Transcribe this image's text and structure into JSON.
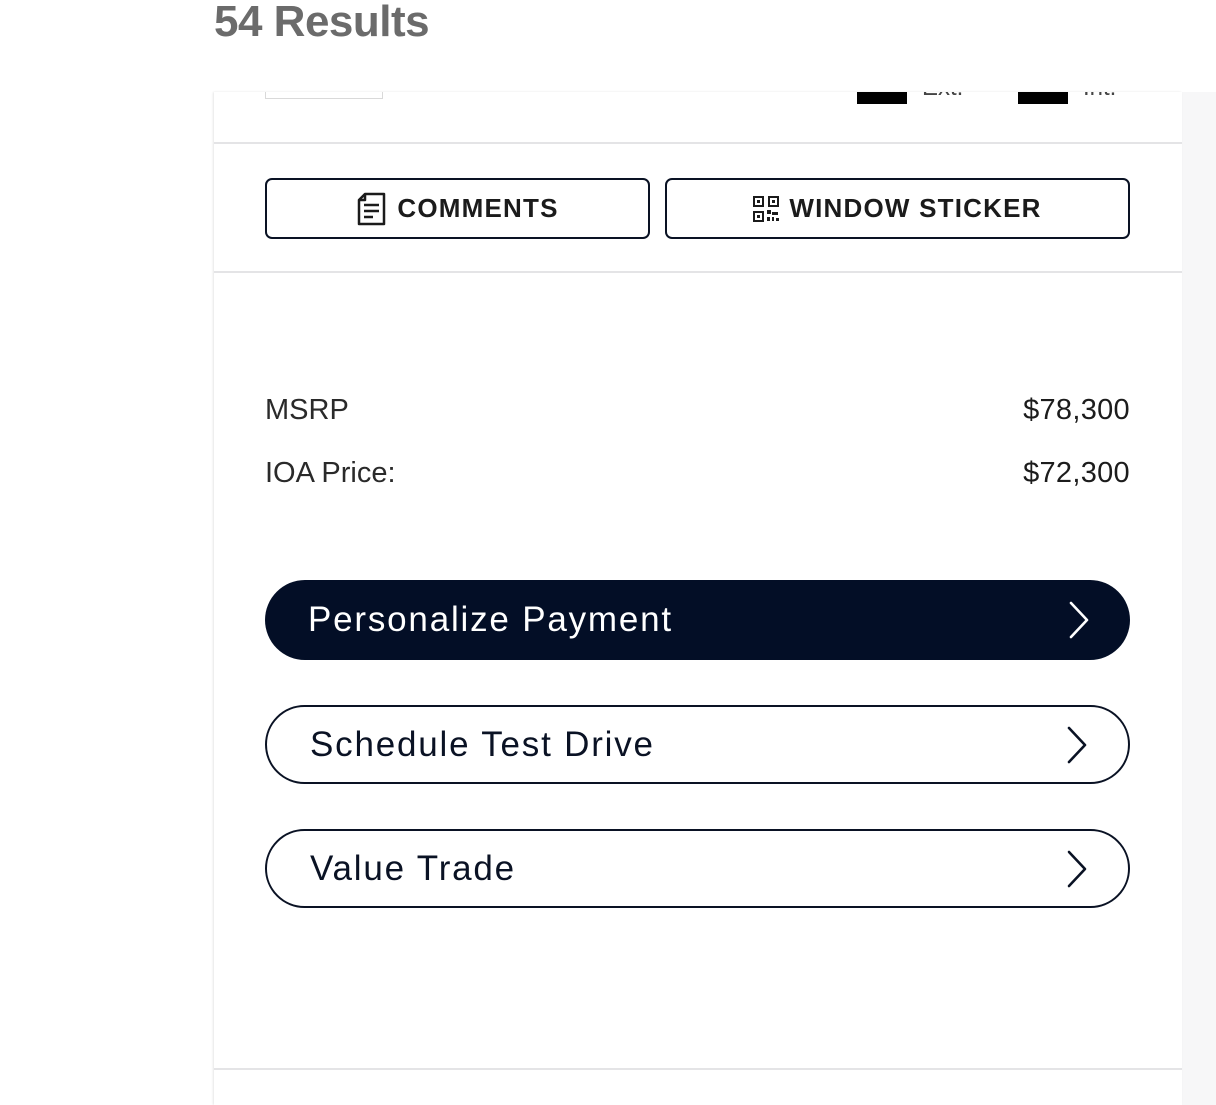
{
  "header": {
    "results_title": "54 Results"
  },
  "card": {
    "clipped_row": {
      "option_labels": [
        "Ext.",
        "Int."
      ]
    },
    "actions": {
      "comments_label": "COMMENTS",
      "window_sticker_label": "WINDOW STICKER"
    },
    "pricing": {
      "msrp_label": "MSRP",
      "msrp_value": "$78,300",
      "ioa_label": "IOA Price:",
      "ioa_value": "$72,300"
    },
    "ctas": {
      "personalize_payment": "Personalize Payment",
      "schedule_test_drive": "Schedule Test Drive",
      "value_trade": "Value Trade"
    }
  },
  "colors": {
    "primary_navy": "#030e26",
    "title_gray": "#6b6b6b",
    "border_dark": "#0a1224",
    "divider": "#e4e4e6"
  },
  "icons": [
    "document-icon",
    "qr-code-icon",
    "chevron-right-icon"
  ]
}
